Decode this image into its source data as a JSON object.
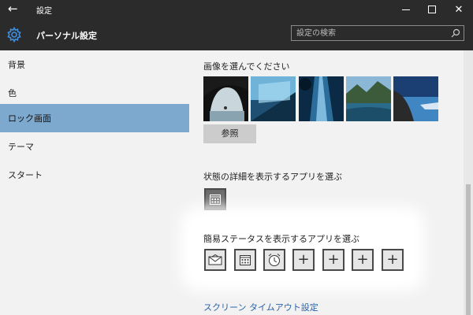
{
  "window": {
    "back_glyph": "←",
    "title": "設定",
    "minimize_icon": "minimize-icon",
    "maximize_icon": "maximize-icon",
    "close_glyph": "✕"
  },
  "header": {
    "page_title": "パーソナル設定",
    "search_placeholder": "設定の検索",
    "icon": "gear-icon"
  },
  "sidebar": {
    "items": [
      {
        "label": "背景",
        "active": false
      },
      {
        "label": "色",
        "active": false
      },
      {
        "label": "ロック画面",
        "active": true
      },
      {
        "label": "テーマ",
        "active": false
      },
      {
        "label": "スタート",
        "active": false
      }
    ],
    "active_color": "#7ea9cf"
  },
  "main": {
    "choose_image_title": "画像を選んでください",
    "browse_label": "参照",
    "detailed_status_title": "状態の詳細を表示するアプリを選ぶ",
    "quick_status_title": "簡易ステータスを表示するアプリを選ぶ",
    "quick_status_apps": [
      "mail-icon",
      "calendar-icon",
      "alarm-clock-icon",
      "plus-icon",
      "plus-icon",
      "plus-icon",
      "plus-icon"
    ],
    "plus_glyph": "+",
    "screen_timeout_link": "スクリーン タイムアウト設定",
    "link_color": "#2b62a8"
  }
}
